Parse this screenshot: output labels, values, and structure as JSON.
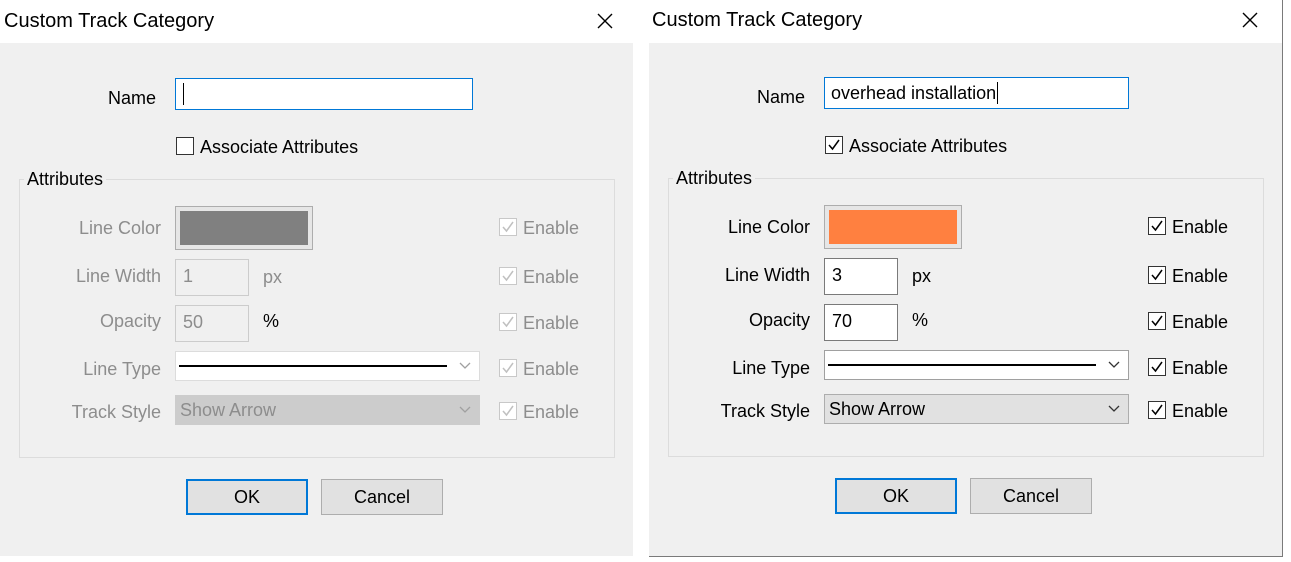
{
  "dialogs": [
    {
      "title": "Custom Track Category",
      "name_label": "Name",
      "name_value": "",
      "associate_label": "Associate Attributes",
      "associate_checked": false,
      "group_label": "Attributes",
      "line_color_label": "Line Color",
      "line_color": "#808080",
      "line_width_label": "Line Width",
      "line_width_value": "1",
      "line_width_unit": "px",
      "opacity_label": "Opacity",
      "opacity_value": "50",
      "opacity_unit": "%",
      "line_type_label": "Line Type",
      "track_style_label": "Track Style",
      "track_style_value": "Show Arrow",
      "enable_label": "Enable",
      "ok_label": "OK",
      "cancel_label": "Cancel",
      "attributes_enabled": false
    },
    {
      "title": "Custom Track Category",
      "name_label": "Name",
      "name_value": "overhead installation",
      "associate_label": "Associate Attributes",
      "associate_checked": true,
      "group_label": "Attributes",
      "line_color_label": "Line Color",
      "line_color": "#ff8040",
      "line_width_label": "Line Width",
      "line_width_value": "3",
      "line_width_unit": "px",
      "opacity_label": "Opacity",
      "opacity_value": "70",
      "opacity_unit": "%",
      "line_type_label": "Line Type",
      "track_style_label": "Track Style",
      "track_style_value": "Show Arrow",
      "enable_label": "Enable",
      "ok_label": "OK",
      "cancel_label": "Cancel",
      "attributes_enabled": true
    }
  ],
  "colors": {
    "dialog_bg": "#f0f0f0",
    "accent": "#0078d7",
    "disabled_text": "#8d8d8d"
  }
}
